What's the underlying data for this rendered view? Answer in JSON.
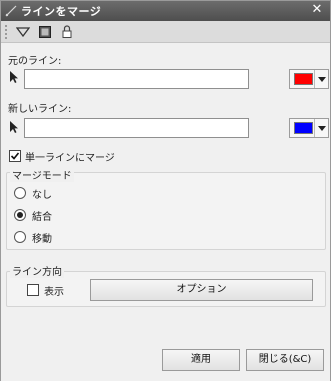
{
  "window": {
    "title": "ラインをマージ",
    "close_glyph": "✕"
  },
  "toolbar": {
    "items": [
      "filter-icon",
      "image-icon",
      "lock-icon"
    ]
  },
  "source_line": {
    "label": "元のライン:",
    "value": "",
    "color": "#ff0000"
  },
  "new_line": {
    "label": "新しいライン:",
    "value": "",
    "color": "#0000ff"
  },
  "merge_single": {
    "label": "単一ラインにマージ",
    "checked": true
  },
  "merge_mode": {
    "title": "マージモード",
    "options": [
      {
        "label": "なし",
        "selected": false
      },
      {
        "label": "結合",
        "selected": true
      },
      {
        "label": "移動",
        "selected": false
      }
    ]
  },
  "line_direction": {
    "title": "ライン方向",
    "show_label": "表示",
    "show_checked": false,
    "option_button": "オプション"
  },
  "footer": {
    "apply": "適用",
    "close": "閉じる(&C)"
  }
}
